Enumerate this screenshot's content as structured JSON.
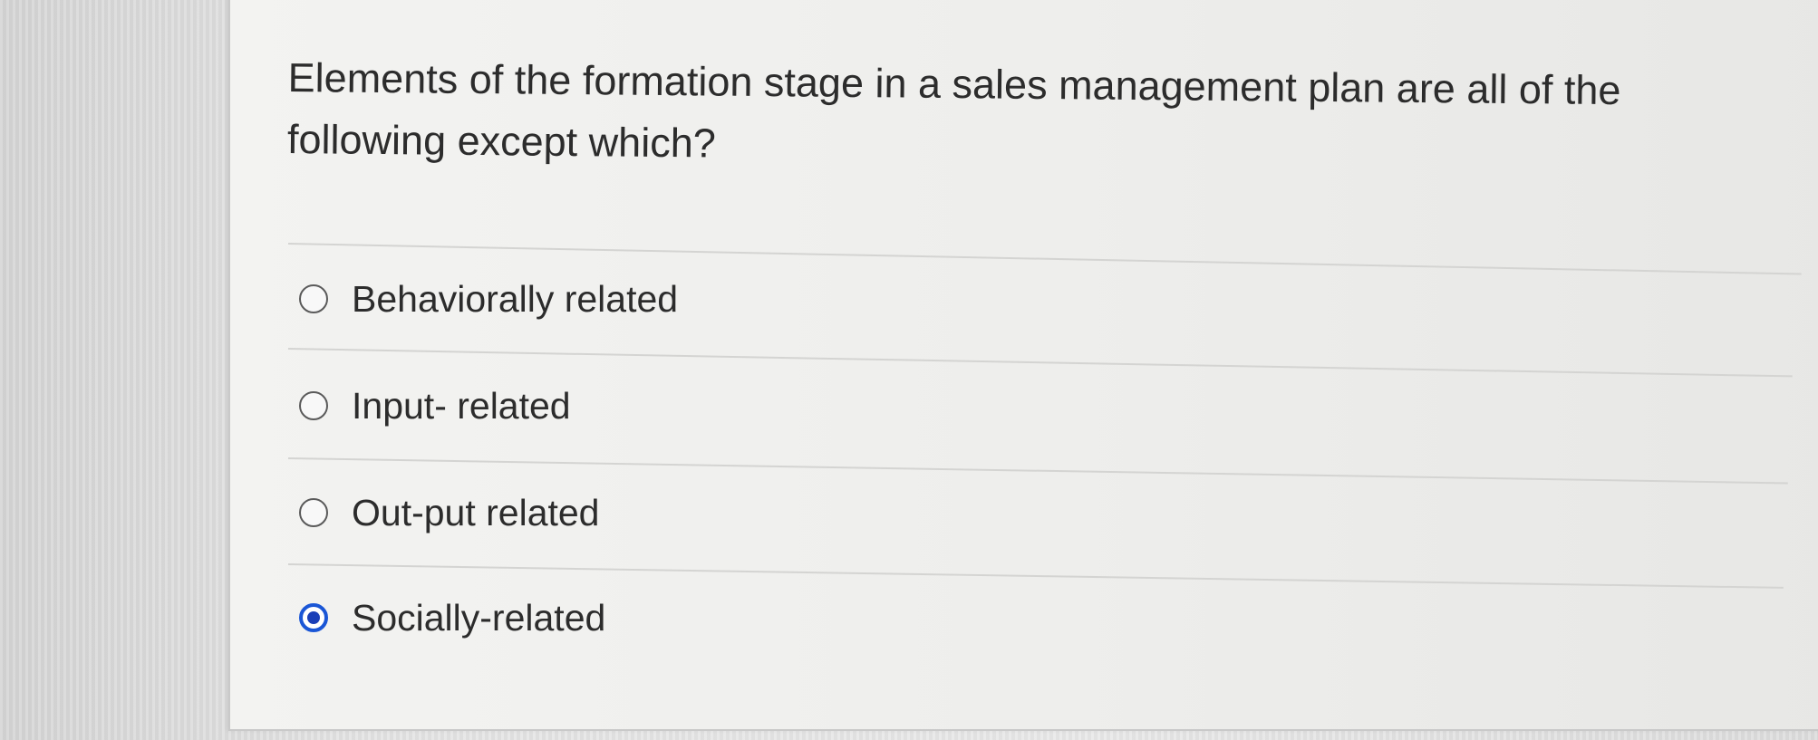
{
  "question": {
    "text": "Elements of the formation stage in a sales management plan are all of the following except which?"
  },
  "options": [
    {
      "label": "Behaviorally related",
      "selected": false
    },
    {
      "label": "Input- related",
      "selected": false
    },
    {
      "label": "Out-put related",
      "selected": false
    },
    {
      "label": "Socially-related",
      "selected": true
    }
  ],
  "colors": {
    "selected_radio": "#1a56d6",
    "text": "#2c2c2c",
    "card_background": "#f1f1ef"
  }
}
